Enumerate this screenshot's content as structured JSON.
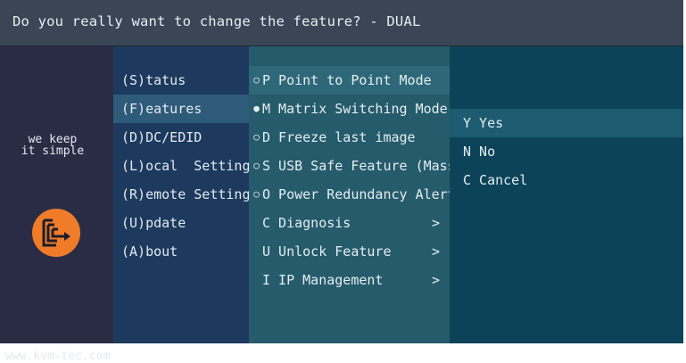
{
  "dialog": {
    "title": "Do you really want to change the feature? - DUAL"
  },
  "brand": {
    "slogan_line1": "we keep",
    "slogan_line2": "it simple",
    "logo_icon": "kvm-tec-logo-icon",
    "website": "www.kvm-tec.com",
    "logo_color": "#f07c2a"
  },
  "main_menu": {
    "items": [
      {
        "label": "(S)tatus"
      },
      {
        "label": "(F)eatures",
        "selected": true
      },
      {
        "label": "(D)DC/EDID"
      },
      {
        "label": "(L)ocal  Settings"
      },
      {
        "label": "(R)emote Settings"
      },
      {
        "label": "(U)pdate"
      },
      {
        "label": "(A)bout"
      }
    ]
  },
  "feature_menu": {
    "items": [
      {
        "bullet": "○",
        "label": "P Point to Point Mode",
        "selected": true
      },
      {
        "bullet": "●",
        "label": "M Matrix Switching Mode"
      },
      {
        "bullet": "○",
        "label": "D Freeze last image"
      },
      {
        "bullet": "○",
        "label": "S USB Safe Feature (Mass S"
      },
      {
        "bullet": "○",
        "label": "O Power Redundancy Alert"
      },
      {
        "bullet": "",
        "label": "C Diagnosis",
        "chevron": ">"
      },
      {
        "bullet": "",
        "label": "U Unlock Feature",
        "chevron": ">"
      },
      {
        "bullet": "",
        "label": "I IP Management",
        "chevron": ">"
      }
    ]
  },
  "confirm_menu": {
    "items": [
      {
        "label": "Y Yes",
        "selected": true
      },
      {
        "label": "N No"
      },
      {
        "label": "C Cancel"
      }
    ]
  }
}
